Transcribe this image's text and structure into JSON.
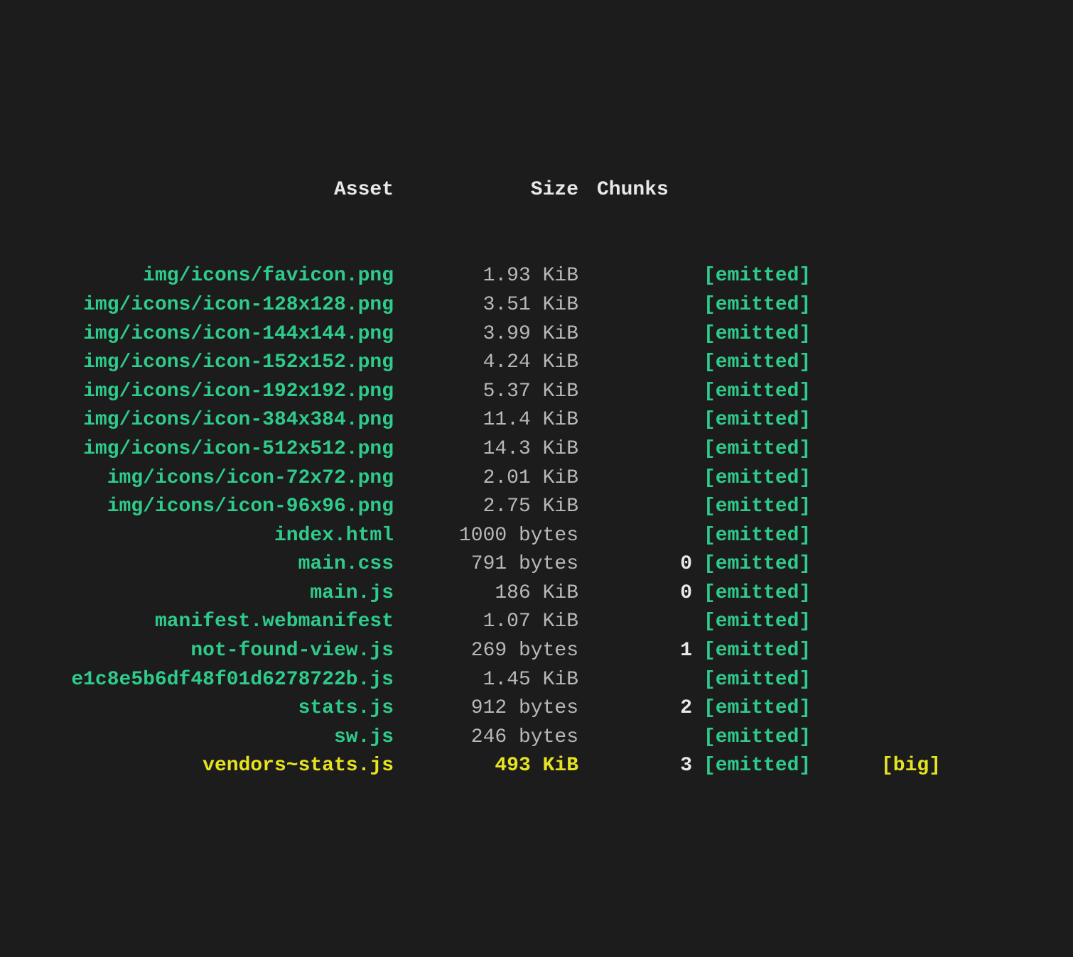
{
  "headers": {
    "asset": "Asset",
    "size": "Size",
    "chunks": "Chunks"
  },
  "rows": [
    {
      "asset": "img/icons/favicon.png",
      "size": "1.93 KiB",
      "chunks": "",
      "status": "[emitted]",
      "flag": "",
      "big": false
    },
    {
      "asset": "img/icons/icon-128x128.png",
      "size": "3.51 KiB",
      "chunks": "",
      "status": "[emitted]",
      "flag": "",
      "big": false
    },
    {
      "asset": "img/icons/icon-144x144.png",
      "size": "3.99 KiB",
      "chunks": "",
      "status": "[emitted]",
      "flag": "",
      "big": false
    },
    {
      "asset": "img/icons/icon-152x152.png",
      "size": "4.24 KiB",
      "chunks": "",
      "status": "[emitted]",
      "flag": "",
      "big": false
    },
    {
      "asset": "img/icons/icon-192x192.png",
      "size": "5.37 KiB",
      "chunks": "",
      "status": "[emitted]",
      "flag": "",
      "big": false
    },
    {
      "asset": "img/icons/icon-384x384.png",
      "size": "11.4 KiB",
      "chunks": "",
      "status": "[emitted]",
      "flag": "",
      "big": false
    },
    {
      "asset": "img/icons/icon-512x512.png",
      "size": "14.3 KiB",
      "chunks": "",
      "status": "[emitted]",
      "flag": "",
      "big": false
    },
    {
      "asset": "img/icons/icon-72x72.png",
      "size": "2.01 KiB",
      "chunks": "",
      "status": "[emitted]",
      "flag": "",
      "big": false
    },
    {
      "asset": "img/icons/icon-96x96.png",
      "size": "2.75 KiB",
      "chunks": "",
      "status": "[emitted]",
      "flag": "",
      "big": false
    },
    {
      "asset": "index.html",
      "size": "1000 bytes",
      "chunks": "",
      "status": "[emitted]",
      "flag": "",
      "big": false
    },
    {
      "asset": "main.css",
      "size": "791 bytes",
      "chunks": "0",
      "status": "[emitted]",
      "flag": "",
      "big": false
    },
    {
      "asset": "main.js",
      "size": "186 KiB",
      "chunks": "0",
      "status": "[emitted]",
      "flag": "",
      "big": false
    },
    {
      "asset": "manifest.webmanifest",
      "size": "1.07 KiB",
      "chunks": "",
      "status": "[emitted]",
      "flag": "",
      "big": false
    },
    {
      "asset": "not-found-view.js",
      "size": "269 bytes",
      "chunks": "1",
      "status": "[emitted]",
      "flag": "",
      "big": false
    },
    {
      "asset": "e1c8e5b6df48f01d6278722b.js",
      "size": "1.45 KiB",
      "chunks": "",
      "status": "[emitted]",
      "flag": "",
      "big": false
    },
    {
      "asset": "stats.js",
      "size": "912 bytes",
      "chunks": "2",
      "status": "[emitted]",
      "flag": "",
      "big": false
    },
    {
      "asset": "sw.js",
      "size": "246 bytes",
      "chunks": "",
      "status": "[emitted]",
      "flag": "",
      "big": false
    },
    {
      "asset": "vendors~stats.js",
      "size": "493 KiB",
      "chunks": "3",
      "status": "[emitted]",
      "flag": "[big]",
      "big": true
    }
  ]
}
